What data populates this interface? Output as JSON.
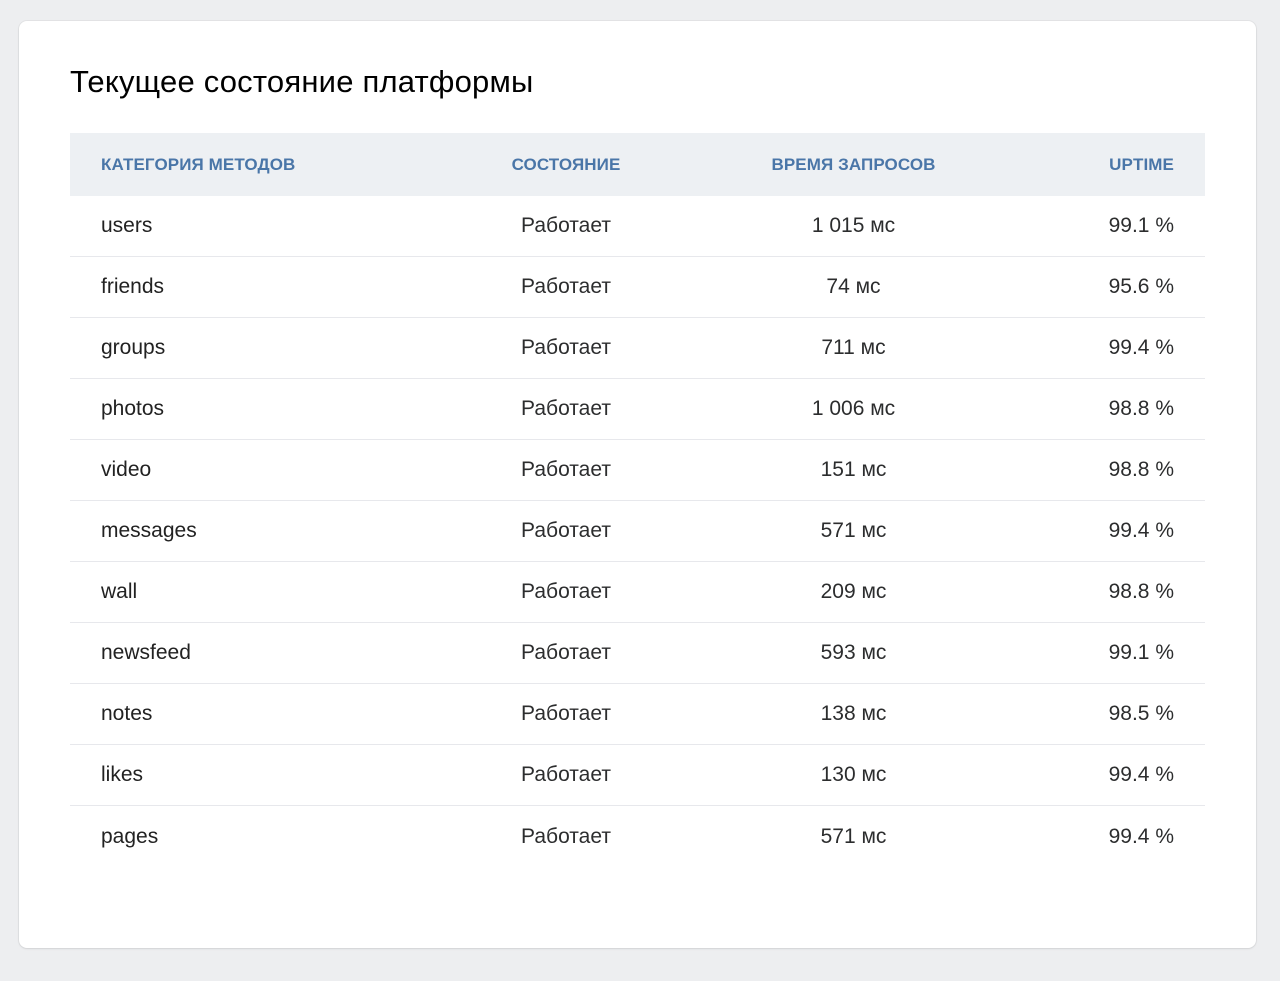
{
  "title": "Текущее состояние платформы",
  "table": {
    "headers": {
      "category": "Категория методов",
      "status": "Состояние",
      "time": "Время запросов",
      "uptime": "Uptime"
    },
    "rows": [
      {
        "name": "users",
        "status": "Работает",
        "time": "1 015 мс",
        "uptime": "99.1 %"
      },
      {
        "name": "friends",
        "status": "Работает",
        "time": "74 мс",
        "uptime": "95.6 %"
      },
      {
        "name": "groups",
        "status": "Работает",
        "time": "711 мс",
        "uptime": "99.4 %"
      },
      {
        "name": "photos",
        "status": "Работает",
        "time": "1 006 мс",
        "uptime": "98.8 %"
      },
      {
        "name": "video",
        "status": "Работает",
        "time": "151 мс",
        "uptime": "98.8 %"
      },
      {
        "name": "messages",
        "status": "Работает",
        "time": "571 мс",
        "uptime": "99.4 %"
      },
      {
        "name": "wall",
        "status": "Работает",
        "time": "209 мс",
        "uptime": "98.8 %"
      },
      {
        "name": "newsfeed",
        "status": "Работает",
        "time": "593 мс",
        "uptime": "99.1 %"
      },
      {
        "name": "notes",
        "status": "Работает",
        "time": "138 мс",
        "uptime": "98.5 %"
      },
      {
        "name": "likes",
        "status": "Работает",
        "time": "130 мс",
        "uptime": "99.4 %"
      },
      {
        "name": "pages",
        "status": "Работает",
        "time": "571 мс",
        "uptime": "99.4 %"
      }
    ]
  },
  "colors": {
    "page_background": "#edeef0",
    "header_background": "#edf0f3",
    "header_text": "#4a76a8",
    "row_divider": "#e7e8ec"
  }
}
